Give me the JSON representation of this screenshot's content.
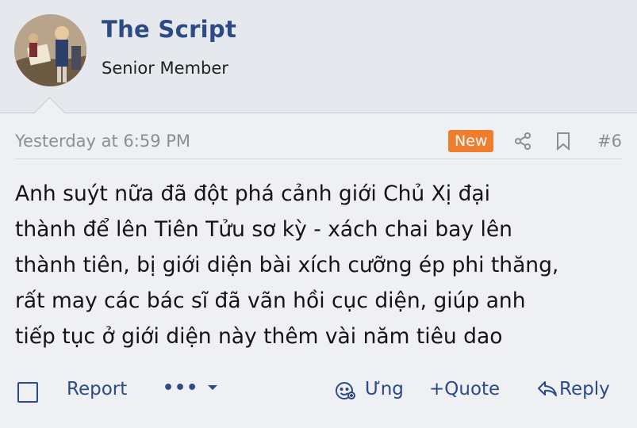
{
  "user": {
    "name": "The Script",
    "title": "Senior Member",
    "avatar_icon": "avatar-painting"
  },
  "post": {
    "timestamp": "Yesterday at 6:59 PM",
    "new_badge": "New",
    "post_number": "#6",
    "body_lines": [
      "Anh suýt nữa đã đột phá cảnh giới Chủ Xị đại",
      "thành để lên Tiên Tửu sơ kỳ - xách chai bay lên",
      "thành tiên, bị giới diện bài xích cưỡng ép phi thăng,",
      "rất may các bác sĩ đã vãn hồi cục diện, giúp anh",
      "tiếp tục ở giới diện này thêm vài năm tiêu dao"
    ]
  },
  "actions": {
    "report": "Report",
    "more": "•••",
    "react": "Ưng",
    "quote": "+Quote",
    "reply": "Reply"
  },
  "colors": {
    "accent": "#2c4a85",
    "badge": "#f07c2e",
    "muted": "#8a8f96",
    "background": "#eef0f3",
    "header_background": "#e5e8ec"
  }
}
